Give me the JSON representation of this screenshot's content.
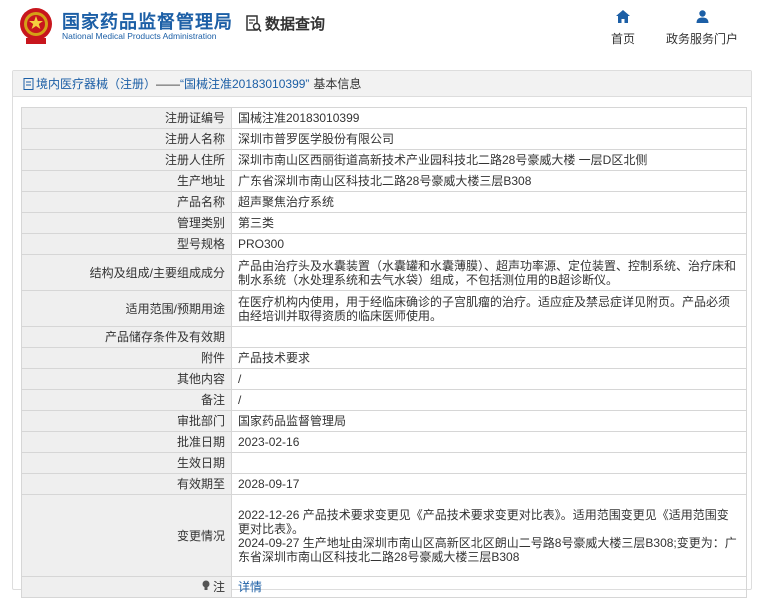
{
  "header": {
    "brand_cn": "国家药品监督管理局",
    "brand_en": "National Medical Products Administration",
    "query_label": "数据查询",
    "nav": [
      {
        "label": "首页",
        "icon": "home-icon"
      },
      {
        "label": "政务服务门户",
        "icon": "user-icon"
      }
    ]
  },
  "breadcrumb": {
    "category": "境内医疗器械（注册）",
    "sep": "——",
    "record": "“国械注准20183010399”",
    "suffix": "基本信息"
  },
  "rows": [
    {
      "label": "注册证编号",
      "value": "国械注准20183010399"
    },
    {
      "label": "注册人名称",
      "value": "深圳市普罗医学股份有限公司"
    },
    {
      "label": "注册人住所",
      "value": "深圳市南山区西丽街道高新技术产业园科技北二路28号豪威大楼 一层D区北侧"
    },
    {
      "label": "生产地址",
      "value": "广东省深圳市南山区科技北二路28号豪威大楼三层B308"
    },
    {
      "label": "产品名称",
      "value": "超声聚焦治疗系统"
    },
    {
      "label": "管理类别",
      "value": "第三类"
    },
    {
      "label": "型号规格",
      "value": "PRO300"
    },
    {
      "label": "结构及组成/主要组成成分",
      "value": "产品由治疗头及水囊装置（水囊罐和水囊薄膜）、超声功率源、定位装置、控制系统、治疗床和制水系统（水处理系统和去气水袋）组成，不包括测位用的B超诊断仪。"
    },
    {
      "label": "适用范围/预期用途",
      "value": "在医疗机构内使用，用于经临床确诊的子宫肌瘤的治疗。适应症及禁忌症详见附页。产品必须由经培训并取得资质的临床医师使用。"
    },
    {
      "label": "产品储存条件及有效期",
      "value": ""
    },
    {
      "label": "附件",
      "value": "产品技术要求"
    },
    {
      "label": "其他内容",
      "value": "/"
    },
    {
      "label": "备注",
      "value": "/"
    },
    {
      "label": "审批部门",
      "value": "国家药品监督管理局"
    },
    {
      "label": "批准日期",
      "value": "2023-02-16"
    },
    {
      "label": "生效日期",
      "value": ""
    },
    {
      "label": "有效期至",
      "value": "2028-09-17"
    },
    {
      "label": "变更情况",
      "value": "2022-12-26 产品技术要求变更见《产品技术要求变更对比表》。适用范围变更见《适用范围变更对比表》。\n2024-09-27 生产地址由深圳市南山区高新区北区朗山二号路8号豪威大楼三层B308;变更为：广东省深圳市南山区科技北二路28号豪威大楼三层B308"
    },
    {
      "label": "注",
      "value": "详情"
    }
  ]
}
